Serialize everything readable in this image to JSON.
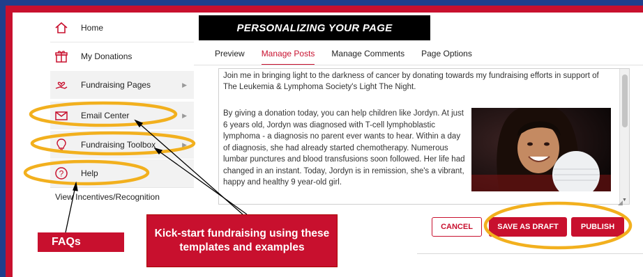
{
  "sidebar": {
    "items": [
      {
        "label": "Home",
        "icon": "home-icon"
      },
      {
        "label": "My Donations",
        "icon": "gift-icon"
      },
      {
        "label": "Fundraising Pages",
        "icon": "hand-heart-icon"
      },
      {
        "label": "Email Center",
        "icon": "envelope-icon"
      },
      {
        "label": "Fundraising Toolbox",
        "icon": "lightbulb-icon"
      },
      {
        "label": "Help",
        "icon": "help-icon"
      }
    ],
    "incentives_label": "View Incentives/Recognition"
  },
  "header": {
    "title": "PERSONALIZING YOUR PAGE"
  },
  "tabs": [
    {
      "label": "Preview"
    },
    {
      "label": "Manage Posts",
      "active": true
    },
    {
      "label": "Manage Comments"
    },
    {
      "label": "Page Options"
    }
  ],
  "editor": {
    "intro": "Join me in bringing light to the darkness of cancer by donating towards my fundraising efforts in support of The Leukemia & Lymphoma Society's Light The Night.",
    "story": "By giving a donation today, you can help children like Jordyn. At just 6 years old, Jordyn was diagnosed with T-cell lymphoblastic lymphoma - a diagnosis no parent ever wants to hear. Within a day of diagnosis, she had already started chemotherapy. Numerous lumbar punctures and blood transfusions soon followed. Her life had changed in an instant. Today, Jordyn is in remission, she's a vibrant, happy and healthy 9 year-old girl."
  },
  "buttons": {
    "cancel": "CANCEL",
    "save_draft": "SAVE AS DRAFT",
    "publish": "PUBLISH"
  },
  "callouts": {
    "templates": "Kick-start fundraising using these templates and examples",
    "faqs": "FAQs"
  },
  "colors": {
    "brand_red": "#c8102e",
    "highlight_ring": "#f2b01e",
    "frame_blue": "#1f3f8c"
  }
}
